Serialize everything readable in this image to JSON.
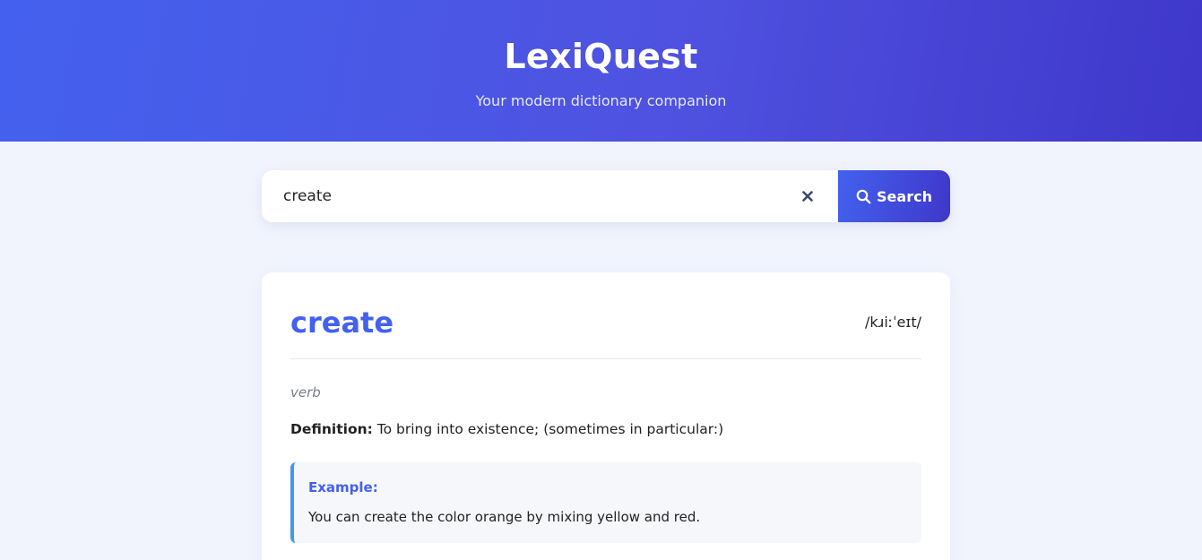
{
  "header": {
    "title": "LexiQuest",
    "subtitle": "Your modern dictionary companion"
  },
  "search": {
    "value": "create",
    "clear_icon": "close-icon",
    "button_icon": "search-icon",
    "button_label": "Search"
  },
  "entry": {
    "word": "create",
    "phonetic": "/kɹiːˈeɪt/",
    "part_of_speech": "verb",
    "definition_label": "Definition:",
    "definition_text": " To bring into existence; (sometimes in particular:)",
    "example_label": "Example:",
    "example_text": "You can create the color orange by mixing yellow and red."
  },
  "colors": {
    "accent": "#4361ee",
    "accent_dark": "#3f37c9",
    "example_border": "#4895ef",
    "page_background": "#f1f4fd"
  }
}
